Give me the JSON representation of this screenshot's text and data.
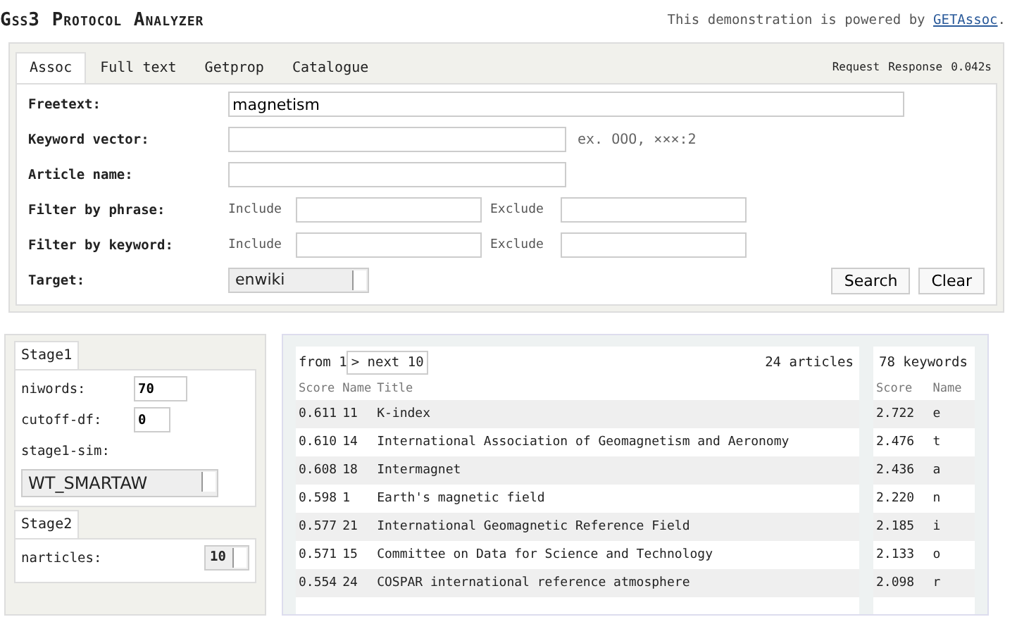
{
  "header": {
    "title": "Gss3 Protocol Analyzer",
    "powered_text": "This demonstration is powered by",
    "powered_link": "GETAssoc",
    "powered_end": "."
  },
  "tabs": [
    {
      "label": "Assoc",
      "selected": true
    },
    {
      "label": "Full text",
      "selected": false
    },
    {
      "label": "Getprop",
      "selected": false
    },
    {
      "label": "Catalogue",
      "selected": false
    }
  ],
  "tab_links": [
    "Request",
    "Response"
  ],
  "response_time": "0.042s",
  "form": {
    "freetext": {
      "label": "Freetext:",
      "value": "magnetism"
    },
    "keyword_vector": {
      "label": "Keyword vector:",
      "hint": "ex. OOO, ×××:2"
    },
    "article_name": {
      "label": "Article name:"
    },
    "filters": [
      {
        "label": "Filter by phrase:",
        "include": "Include",
        "exclude": "Exclude"
      },
      {
        "label": "Filter by keyword:",
        "include": "Include",
        "exclude": "Exclude"
      }
    ],
    "target": {
      "label": "Target:",
      "value": "enwiki"
    },
    "buttons": [
      "Search",
      "Clear"
    ]
  },
  "stage1": {
    "title": "Stage1",
    "niwords": {
      "label": "niwords:",
      "value": "70"
    },
    "cutoff_df": {
      "label": "cutoff-df:",
      "value": "0"
    },
    "sim": {
      "label": "stage1-sim:",
      "value": "WT_SMARTAW"
    }
  },
  "stage2": {
    "title": "Stage2",
    "narticles": {
      "label": "narticles:",
      "value": "10"
    }
  },
  "results": {
    "from": "from 1",
    "next": "> next 10",
    "articles_count": "24 articles",
    "columns": [
      "Score",
      "Name",
      "Title"
    ],
    "rows": [
      {
        "score": "0.611",
        "name": "11",
        "title": "K-index"
      },
      {
        "score": "0.610",
        "name": "14",
        "title": "International Association of Geomagnetism and Aeronomy"
      },
      {
        "score": "0.608",
        "name": "18",
        "title": "Intermagnet"
      },
      {
        "score": "0.598",
        "name": "1",
        "title": "Earth's magnetic field"
      },
      {
        "score": "0.577",
        "name": "21",
        "title": "International Geomagnetic Reference Field"
      },
      {
        "score": "0.571",
        "name": "15",
        "title": "Committee on Data for Science and Technology"
      },
      {
        "score": "0.554",
        "name": "24",
        "title": "COSPAR international reference atmosphere"
      }
    ]
  },
  "keywords": {
    "count": "78 keywords",
    "columns": [
      "Score",
      "Name"
    ],
    "rows": [
      {
        "score": "2.722",
        "name": "e"
      },
      {
        "score": "2.476",
        "name": "t"
      },
      {
        "score": "2.436",
        "name": "a"
      },
      {
        "score": "2.220",
        "name": "n"
      },
      {
        "score": "2.185",
        "name": "i"
      },
      {
        "score": "2.133",
        "name": "o"
      },
      {
        "score": "2.098",
        "name": "r"
      }
    ]
  }
}
